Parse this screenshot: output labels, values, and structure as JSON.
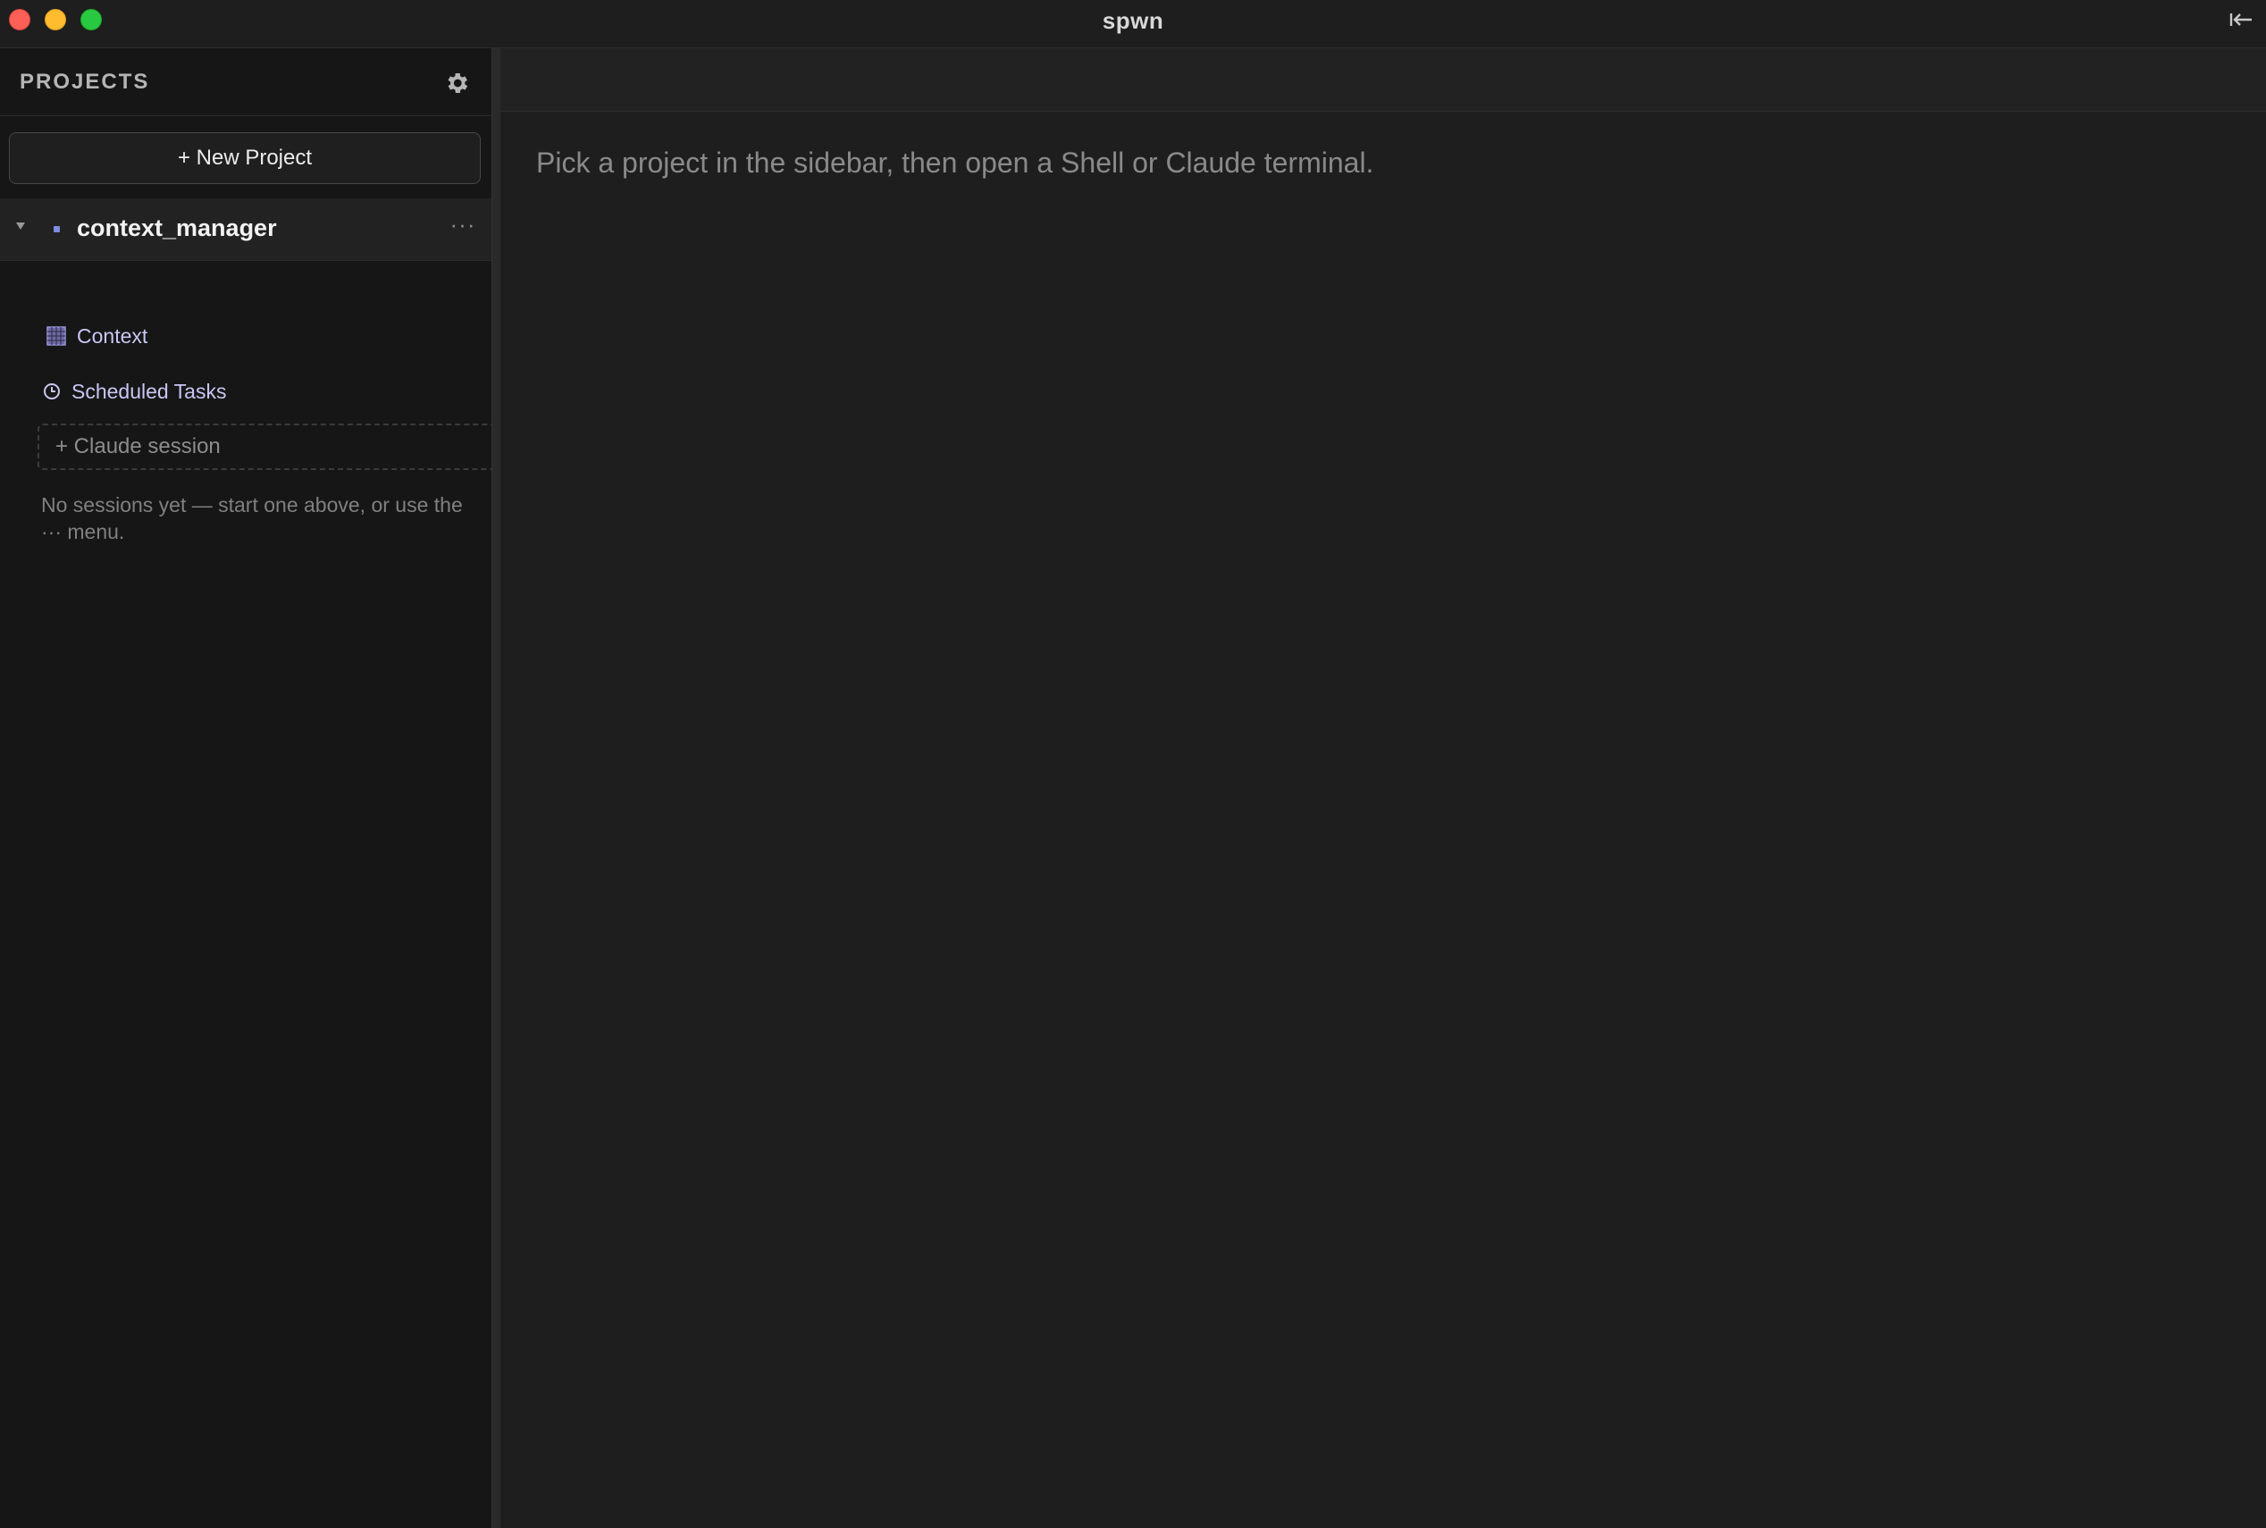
{
  "window": {
    "title": "spwn",
    "controls": [
      "close",
      "minimize",
      "maximize"
    ],
    "collapse_icon": "collapse-panel-icon"
  },
  "sidebar": {
    "title": "PROJECTS",
    "settings_icon": "gear-icon",
    "new_project_label": "+ New Project",
    "project": {
      "name": "context_manager",
      "expanded": true,
      "more_label": "···",
      "items": [
        {
          "label": "Context",
          "icon": "grid-icon"
        },
        {
          "label": "Scheduled Tasks",
          "icon": "clock-icon"
        }
      ],
      "add_session_label": "+ Claude session",
      "empty_hint": "No sessions yet — start one above, or use the ··· menu."
    }
  },
  "main": {
    "hint": "Pick a project in the sidebar, then open a Shell or Claude terminal."
  },
  "colors": {
    "accent": "#c9c6f4",
    "project_dot": "#7f8ce0",
    "close": "#fe5f57",
    "minimize": "#febc2e",
    "maximize": "#28c840"
  }
}
